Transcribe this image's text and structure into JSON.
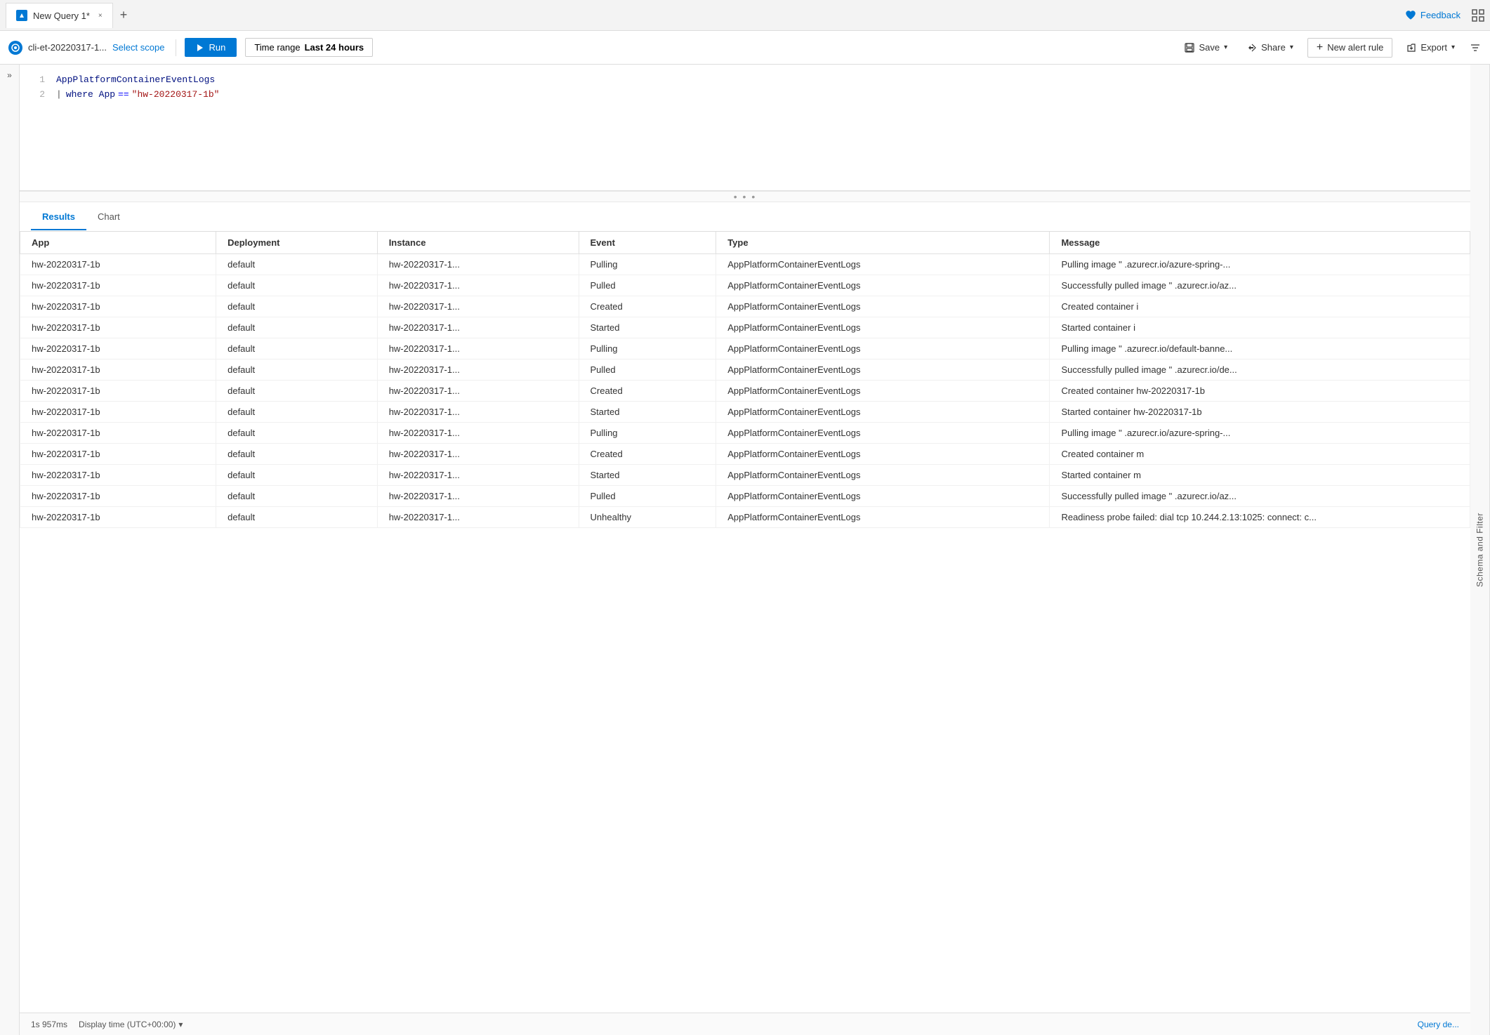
{
  "tab": {
    "title": "New Query 1*",
    "close_label": "×",
    "add_label": "+"
  },
  "feedback": {
    "label": "Feedback"
  },
  "toolbar": {
    "scope_name": "cli-et-20220317-1...",
    "select_scope_label": "Select scope",
    "run_label": "Run",
    "time_range_label": "Time range",
    "time_range_value": "Last 24 hours",
    "save_label": "Save",
    "share_label": "Share",
    "new_alert_label": "New alert rule",
    "export_label": "Export"
  },
  "editor": {
    "line1": "AppPlatformContainerEventLogs",
    "line2_pipe": "|",
    "line2_keyword": "where",
    "line2_field": "App",
    "line2_operator": "==",
    "line2_value": "\"hw-20220317-1b\""
  },
  "results": {
    "tabs": [
      "Results",
      "Chart"
    ],
    "active_tab": "Results",
    "columns": [
      "App",
      "Deployment",
      "Instance",
      "Event",
      "Type",
      "Message"
    ],
    "rows": [
      [
        "hw-20220317-1b",
        "default",
        "hw-20220317-1...",
        "Pulling",
        "AppPlatformContainerEventLogs",
        "Pulling image \"",
        ".azurecr.io/azure-spring-..."
      ],
      [
        "hw-20220317-1b",
        "default",
        "hw-20220317-1...",
        "Pulled",
        "AppPlatformContainerEventLogs",
        "Successfully pulled image \"",
        ".azurecr.io/az..."
      ],
      [
        "hw-20220317-1b",
        "default",
        "hw-20220317-1...",
        "Created",
        "AppPlatformContainerEventLogs",
        "Created container i",
        ""
      ],
      [
        "hw-20220317-1b",
        "default",
        "hw-20220317-1...",
        "Started",
        "AppPlatformContainerEventLogs",
        "Started container i",
        ""
      ],
      [
        "hw-20220317-1b",
        "default",
        "hw-20220317-1...",
        "Pulling",
        "AppPlatformContainerEventLogs",
        "Pulling image \"",
        ".azurecr.io/default-banne..."
      ],
      [
        "hw-20220317-1b",
        "default",
        "hw-20220317-1...",
        "Pulled",
        "AppPlatformContainerEventLogs",
        "Successfully pulled image \"",
        ".azurecr.io/de..."
      ],
      [
        "hw-20220317-1b",
        "default",
        "hw-20220317-1...",
        "Created",
        "AppPlatformContainerEventLogs",
        "Created container hw-20220317-1b",
        ""
      ],
      [
        "hw-20220317-1b",
        "default",
        "hw-20220317-1...",
        "Started",
        "AppPlatformContainerEventLogs",
        "Started container hw-20220317-1b",
        ""
      ],
      [
        "hw-20220317-1b",
        "default",
        "hw-20220317-1...",
        "Pulling",
        "AppPlatformContainerEventLogs",
        "Pulling image \"",
        ".azurecr.io/azure-spring-..."
      ],
      [
        "hw-20220317-1b",
        "default",
        "hw-20220317-1...",
        "Created",
        "AppPlatformContainerEventLogs",
        "Created container m",
        ""
      ],
      [
        "hw-20220317-1b",
        "default",
        "hw-20220317-1...",
        "Started",
        "AppPlatformContainerEventLogs",
        "Started container m",
        ""
      ],
      [
        "hw-20220317-1b",
        "default",
        "hw-20220317-1...",
        "Pulled",
        "AppPlatformContainerEventLogs",
        "Successfully pulled image \"",
        ".azurecr.io/az..."
      ],
      [
        "hw-20220317-1b",
        "default",
        "hw-20220317-1...",
        "Unhealthy",
        "AppPlatformContainerEventLogs",
        "Readiness probe failed: dial tcp 10.244.2.13:1025: connect: c...",
        ""
      ]
    ]
  },
  "status_bar": {
    "elapsed": "1s 957ms",
    "display_time": "Display time (UTC+00:00)",
    "query_details": "Query de..."
  },
  "schema_sidebar": {
    "label": "Schema and Filter"
  }
}
